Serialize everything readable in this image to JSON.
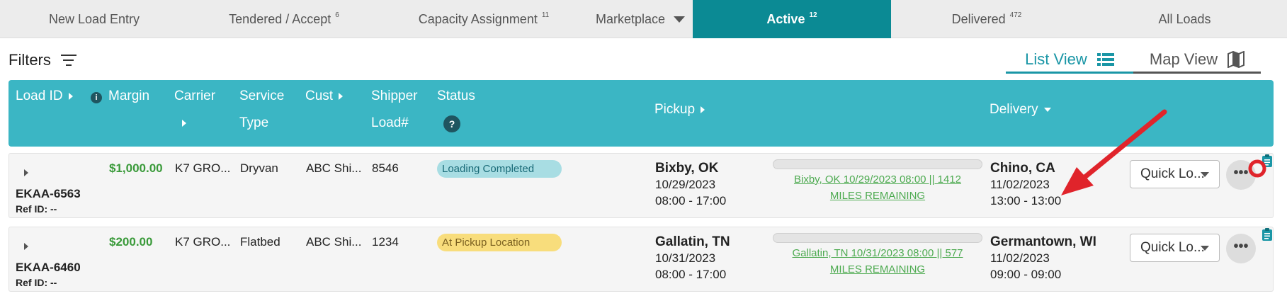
{
  "tabs": [
    {
      "label": "New Load Entry",
      "count": ""
    },
    {
      "label": "Tendered / Accept",
      "count": "6"
    },
    {
      "label": "Capacity Assignment",
      "count": "11"
    },
    {
      "label": "Marketplace",
      "count": ""
    },
    {
      "label": "Active",
      "count": "12"
    },
    {
      "label": "Delivered",
      "count": "472"
    },
    {
      "label": "All Loads",
      "count": ""
    }
  ],
  "active_tab": "Active",
  "filters": {
    "label": "Filters",
    "icon": "filter-lines-icon"
  },
  "views": {
    "list_label": "List View",
    "map_label": "Map View",
    "list_icon": "list-icon",
    "map_icon": "map-icon"
  },
  "columns": {
    "load_id": "Load ID",
    "margin": "Margin",
    "carrier": "Carrier",
    "service_line1": "Service",
    "service_line2": "Type",
    "cust": "Cust",
    "shipper_line1": "Shipper",
    "shipper_line2": "Load#",
    "status": "Status",
    "pickup": "Pickup",
    "delivery": "Delivery",
    "info_glyph": "i",
    "help_glyph": "?"
  },
  "rows": [
    {
      "load_id": "EKAA-6563",
      "ref_id": "Ref ID: --",
      "margin": "$1,000.00",
      "carrier": "K7 GRO...",
      "service_type": "Dryvan",
      "cust": "ABC Shi...",
      "shipper_load": "8546",
      "status": "Loading Completed",
      "pickup_city": "Bixby, OK",
      "pickup_date": "10/29/2023",
      "pickup_time": "08:00 - 17:00",
      "tracking_line1": "Bixby, OK 10/29/2023 08:00 || 1412",
      "tracking_line2": "MILES REMAINING",
      "delivery_city": "Chino, CA",
      "delivery_date": "11/02/2023",
      "delivery_time": "13:00 - 13:00",
      "quick_action": "Quick Lo...",
      "more": "•••"
    },
    {
      "load_id": "EKAA-6460",
      "ref_id": "Ref ID: --",
      "margin": "$200.00",
      "carrier": "K7 GRO...",
      "service_type": "Flatbed",
      "cust": "ABC Shi...",
      "shipper_load": "1234",
      "status": "At Pickup Location",
      "pickup_city": "Gallatin, TN",
      "pickup_date": "10/31/2023",
      "pickup_time": "08:00 - 17:00",
      "tracking_line1": "Gallatin, TN 10/31/2023 08:00 || 577",
      "tracking_line2": "MILES REMAINING",
      "delivery_city": "Germantown, WI",
      "delivery_date": "11/02/2023",
      "delivery_time": "09:00 - 09:00",
      "quick_action": "Quick Lo...",
      "more": "•••"
    }
  ],
  "colors": {
    "accent": "#0b8a94",
    "header": "#3bb6c4",
    "margin_green": "#3a9a3a",
    "annotation_red": "#e0242b"
  }
}
